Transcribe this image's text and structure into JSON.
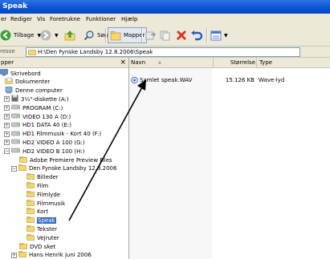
{
  "window": {
    "title": "Speak"
  },
  "menu": [
    "er",
    "Rediger",
    "Vis",
    "Foretrukne",
    "Funktioner",
    "Hjælp"
  ],
  "toolbar": {
    "back_label": "Tilbage",
    "search_label": "Søg",
    "folders_label": "Mapper"
  },
  "address": {
    "label": "resse",
    "path": "H:\\Den Fynske Landsby 12.8.2006\\Speak"
  },
  "folders_pane": {
    "title": "pper",
    "close": "×"
  },
  "tree": [
    {
      "label": "Skrivebord"
    },
    {
      "label": "Dokumenter"
    },
    {
      "label": "Denne computer"
    },
    {
      "label": "3½\"-diskette (A:)",
      "pm": "+"
    },
    {
      "label": "PROGRAM (C:)",
      "pm": "+"
    },
    {
      "label": "VIDEO 130 A (D:)",
      "pm": "+"
    },
    {
      "label": "HD1 DATA 40 (E:)",
      "pm": "+"
    },
    {
      "label": "HD1 Filmmusik - Kort 40 (F:)",
      "pm": "+"
    },
    {
      "label": "HD2 VIDEO A 100 (G:)",
      "pm": "+"
    },
    {
      "label": "HD2 VIDEO B 100 (H:)",
      "pm": "−"
    },
    {
      "label": "Adobe Premiere Preview Files"
    },
    {
      "label": "Den Fynske Landsby 12.8.2006",
      "pm": "−"
    },
    {
      "label": "Billeder"
    },
    {
      "label": "Film"
    },
    {
      "label": "Filmlyde"
    },
    {
      "label": "Filmmusik"
    },
    {
      "label": "Kort"
    },
    {
      "label": "Speak",
      "selected": true
    },
    {
      "label": "Tekster"
    },
    {
      "label": "Vejruter"
    },
    {
      "label": "DVD sket"
    },
    {
      "label": "Hans Henrik juni 2006",
      "pm": "+"
    }
  ],
  "columns": {
    "name": "Navn",
    "sort": "▲",
    "size": "Størrelse",
    "type": "Type"
  },
  "files": [
    {
      "name": "Samlet speak.WAV",
      "size": "15.126 KB",
      "type": "Wave-lyd"
    }
  ],
  "colors": {
    "titlebar": "#0a55d4",
    "selection": "#316ac5",
    "folder": "#f5d76e",
    "arrow": "#000000"
  }
}
